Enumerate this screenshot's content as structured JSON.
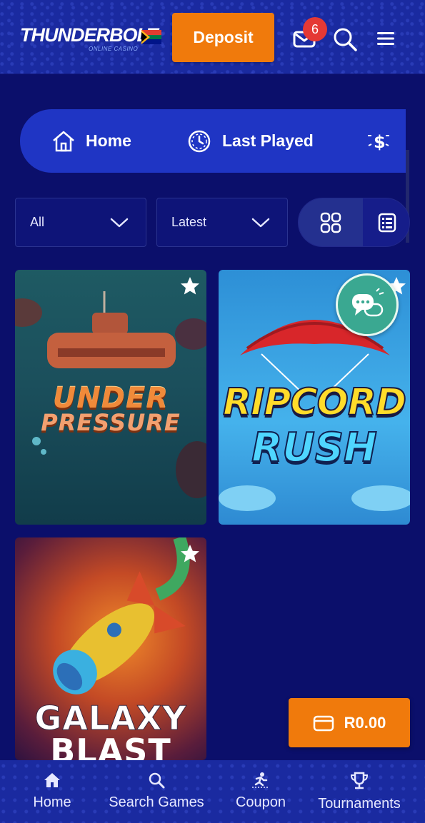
{
  "header": {
    "logo_text": "THUNDERBOLT",
    "logo_subtext": "ONLINE CASINO",
    "deposit_label": "Deposit",
    "mail_badge": "6"
  },
  "nav": {
    "items": [
      {
        "label": "Home",
        "icon": "house-icon"
      },
      {
        "label": "Last Played",
        "icon": "history-clock-icon"
      },
      {
        "label": "",
        "icon": "dollar-sparkle-icon"
      }
    ]
  },
  "filters": {
    "category": "All",
    "sort": "Latest",
    "view_modes": [
      "grid-view-icon",
      "list-view-icon"
    ],
    "active_view": "grid"
  },
  "games": [
    {
      "title_line1": "UNDER",
      "title_line2": "PRESSURE"
    },
    {
      "title_line1": "RIPCORD",
      "title_line2": "RUSH"
    },
    {
      "title_line1": "GALAXY",
      "title_line2": "BLAST"
    }
  ],
  "balance": {
    "label": "R0.00"
  },
  "bottom_nav": {
    "items": [
      {
        "label": "Home",
        "icon": "home-icon"
      },
      {
        "label": "Search Games",
        "icon": "search-icon"
      },
      {
        "label": "Coupon",
        "icon": "coupon-icon"
      },
      {
        "label": "Tournaments",
        "icon": "trophy-icon"
      }
    ]
  },
  "colors": {
    "background": "#0b0f6b",
    "header": "#1a2aa0",
    "accent_orange": "#f07a0c",
    "nav_pill": "#1f35c4",
    "badge_red": "#e53935",
    "chat_green": "#3aa891"
  }
}
